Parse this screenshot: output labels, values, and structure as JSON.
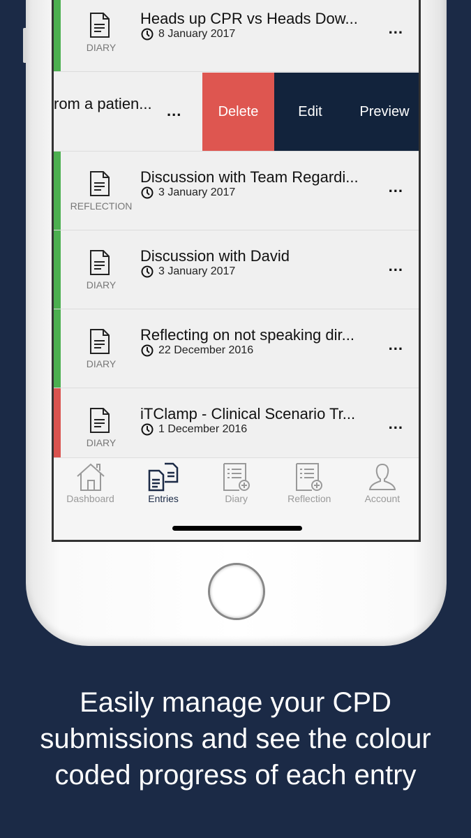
{
  "colors": {
    "background": "#1b2a46",
    "complete": "#4caf50",
    "incomplete": "#d9534f",
    "delete": "#de5650",
    "action": "#12233c"
  },
  "entries": [
    {
      "title": "Heads up CPR vs Heads Dow...",
      "date": "8 January 2017",
      "type": "DIARY",
      "status": "complete"
    },
    {
      "title": "rom a patien...",
      "swiped": true
    },
    {
      "title": "Discussion with Team Regardi...",
      "date": "3 January 2017",
      "type": "REFLECTION",
      "status": "complete"
    },
    {
      "title": "Discussion with David",
      "date": "3 January 2017",
      "type": "DIARY",
      "status": "complete"
    },
    {
      "title": "Reflecting on not speaking dir...",
      "date": "22 December 2016",
      "type": "DIARY",
      "status": "complete"
    },
    {
      "title": "iTClamp - Clinical Scenario Tr...",
      "date": "1 December 2016",
      "type": "DIARY",
      "status": "incomplete"
    }
  ],
  "swipe_actions": {
    "delete": "Delete",
    "edit": "Edit",
    "preview": "Preview"
  },
  "more_icon": "...",
  "tabs": [
    {
      "label": "Dashboard",
      "icon": "home-icon"
    },
    {
      "label": "Entries",
      "icon": "entries-icon",
      "active": true
    },
    {
      "label": "Diary",
      "icon": "add-document-icon"
    },
    {
      "label": "Reflection",
      "icon": "add-document-icon"
    },
    {
      "label": "Account",
      "icon": "user-icon"
    }
  ],
  "caption": "Easily manage your CPD submissions and see the colour coded progress of each entry"
}
